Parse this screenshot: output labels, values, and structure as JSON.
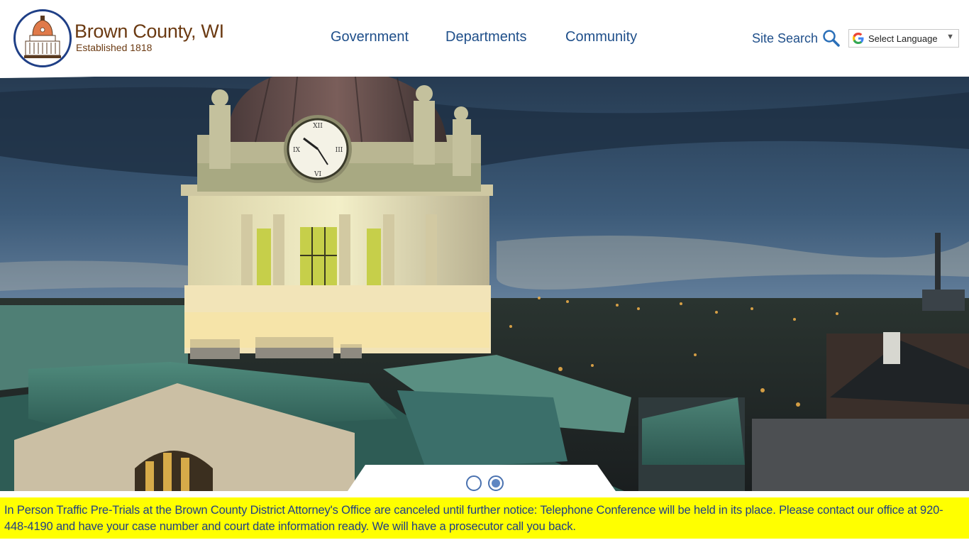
{
  "brand": {
    "name": "Brown County, WI",
    "established": "Established 1818",
    "name_color": "#6b3a12",
    "seal_ring_color": "#1f3f86"
  },
  "nav": {
    "items": [
      {
        "label": "Government"
      },
      {
        "label": "Departments"
      },
      {
        "label": "Community"
      }
    ],
    "link_color": "#1f4f8a"
  },
  "site_search": {
    "label": "Site Search",
    "icon": "magnifier-icon"
  },
  "language": {
    "label": "Select Language",
    "icon": "google-g-icon",
    "caret": "▼"
  },
  "hero": {
    "description_icon": "courthouse-clock-tower-photo",
    "slides_total": 2,
    "active_slide": 2
  },
  "alert": {
    "text": "In Person Traffic Pre-Trials at the Brown County District Attorney's Office are canceled until further notice: Telephone Conference will be held in its place.  Please contact our office at 920-448-4190 and have your case number and court date information ready.  We will have a prosecutor call you back.",
    "background": "#ffff00",
    "text_color": "#1f3f86"
  }
}
